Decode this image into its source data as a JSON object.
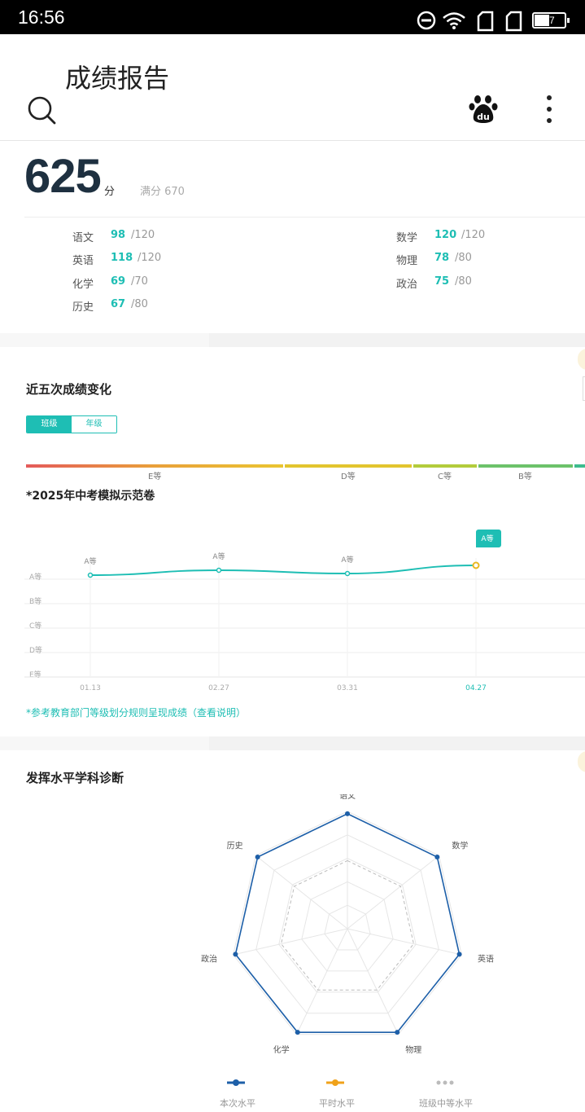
{
  "status_bar": {
    "time": "16:56",
    "battery": "47"
  },
  "app_bar": {
    "title": "成绩报告"
  },
  "score": {
    "total": "625",
    "unit": "分",
    "full_label": "满分 670"
  },
  "subjects": [
    {
      "name": "语文",
      "score": "98",
      "max": "/120"
    },
    {
      "name": "数学",
      "score": "120",
      "max": "/120"
    },
    {
      "name": "英语",
      "score": "118",
      "max": "/120"
    },
    {
      "name": "物理",
      "score": "78",
      "max": "/80"
    },
    {
      "name": "化学",
      "score": "69",
      "max": "/70"
    },
    {
      "name": "政治",
      "score": "75",
      "max": "/80"
    },
    {
      "name": "历史",
      "score": "67",
      "max": "/80"
    }
  ],
  "trend": {
    "title": "近五次成绩变化",
    "toggle": {
      "left": "班级",
      "right": "年级"
    },
    "grade_scale": [
      "E等",
      "D等",
      "C等",
      "B等"
    ],
    "exam_title": "*2025年中考模拟示范卷",
    "note": "*参考教育部门等级划分规则呈现成绩（查看说明）"
  },
  "diagnosis": {
    "title": "发挥水平学科诊断",
    "legend": [
      "本次水平",
      "平时水平",
      "班级中等水平"
    ]
  },
  "colors": {
    "accent": "#1ebeb4",
    "radar_current": "#1d5fa8",
    "radar_usual": "#f0a21a",
    "radar_class": "#bbbbbb"
  },
  "chart_data": [
    {
      "type": "line",
      "x": [
        "01.13",
        "02.27",
        "03.31",
        "04.27"
      ],
      "y_categories": [
        "E等",
        "D等",
        "C等",
        "B等",
        "A等"
      ],
      "series": [
        {
          "values": [
            "A等",
            "A等",
            "A等",
            "A等"
          ],
          "labels": [
            "A等",
            "A等",
            "A等",
            "A等"
          ]
        }
      ],
      "highlight": "04.27"
    },
    {
      "type": "radar",
      "axes": [
        "语文",
        "数学",
        "英语",
        "物理",
        "化学",
        "政治",
        "历史"
      ],
      "series": [
        {
          "name": "本次水平",
          "values": [
            0.98,
            0.98,
            0.98,
            0.98,
            0.98,
            0.98,
            0.98
          ]
        },
        {
          "name": "班级中等水平",
          "values": [
            0.58,
            0.58,
            0.58,
            0.58,
            0.58,
            0.58,
            0.58
          ]
        }
      ],
      "rings": 5
    }
  ]
}
